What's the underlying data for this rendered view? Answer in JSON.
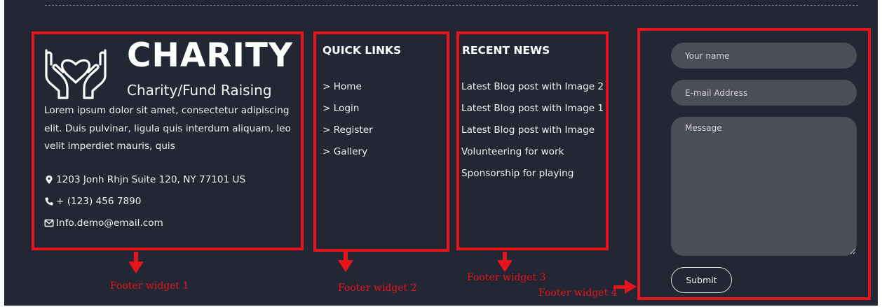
{
  "widget1": {
    "brand_title": "CHARITY",
    "brand_subtitle": "Charity/Fund Raising",
    "about_text": "Lorem ipsum dolor sit amet, consectetur adipiscing elit. Duis pulvinar, ligula quis interdum aliquam, leo velit imperdiet mauris, quis",
    "address": "1203 Jonh Rhjn Suite 120, NY 77101 US",
    "phone": "+ (123) 456 7890",
    "email": "Info.demo@email.com"
  },
  "widget2": {
    "heading": "QUICK LINKS",
    "links": [
      "> Home",
      "> Login",
      "> Register",
      "> Gallery"
    ]
  },
  "widget3": {
    "heading": "RECENT NEWS",
    "news": [
      "Latest Blog post with Image 2",
      "Latest Blog post with Image 1",
      "Latest Blog post with Image",
      "Volunteering for work",
      "Sponsorship for playing"
    ]
  },
  "widget4": {
    "name_placeholder": "Your name",
    "email_placeholder": "E-mail Address",
    "message_placeholder": "Message",
    "submit_label": "Submit"
  },
  "annotations": {
    "w1": "Footer widget 1",
    "w2": "Footer widget 2",
    "w3": "Footer widget 3",
    "w4": "Footer widget 4"
  },
  "colors": {
    "background": "#232733",
    "annotation_red": "#e8141b",
    "input_fill": "#4b4e56"
  },
  "icons": [
    "charity-hands-heart-icon",
    "map-marker-icon",
    "phone-icon",
    "envelope-icon",
    "resize-grip-icon",
    "arrow-down-icon",
    "arrow-right-icon"
  ]
}
